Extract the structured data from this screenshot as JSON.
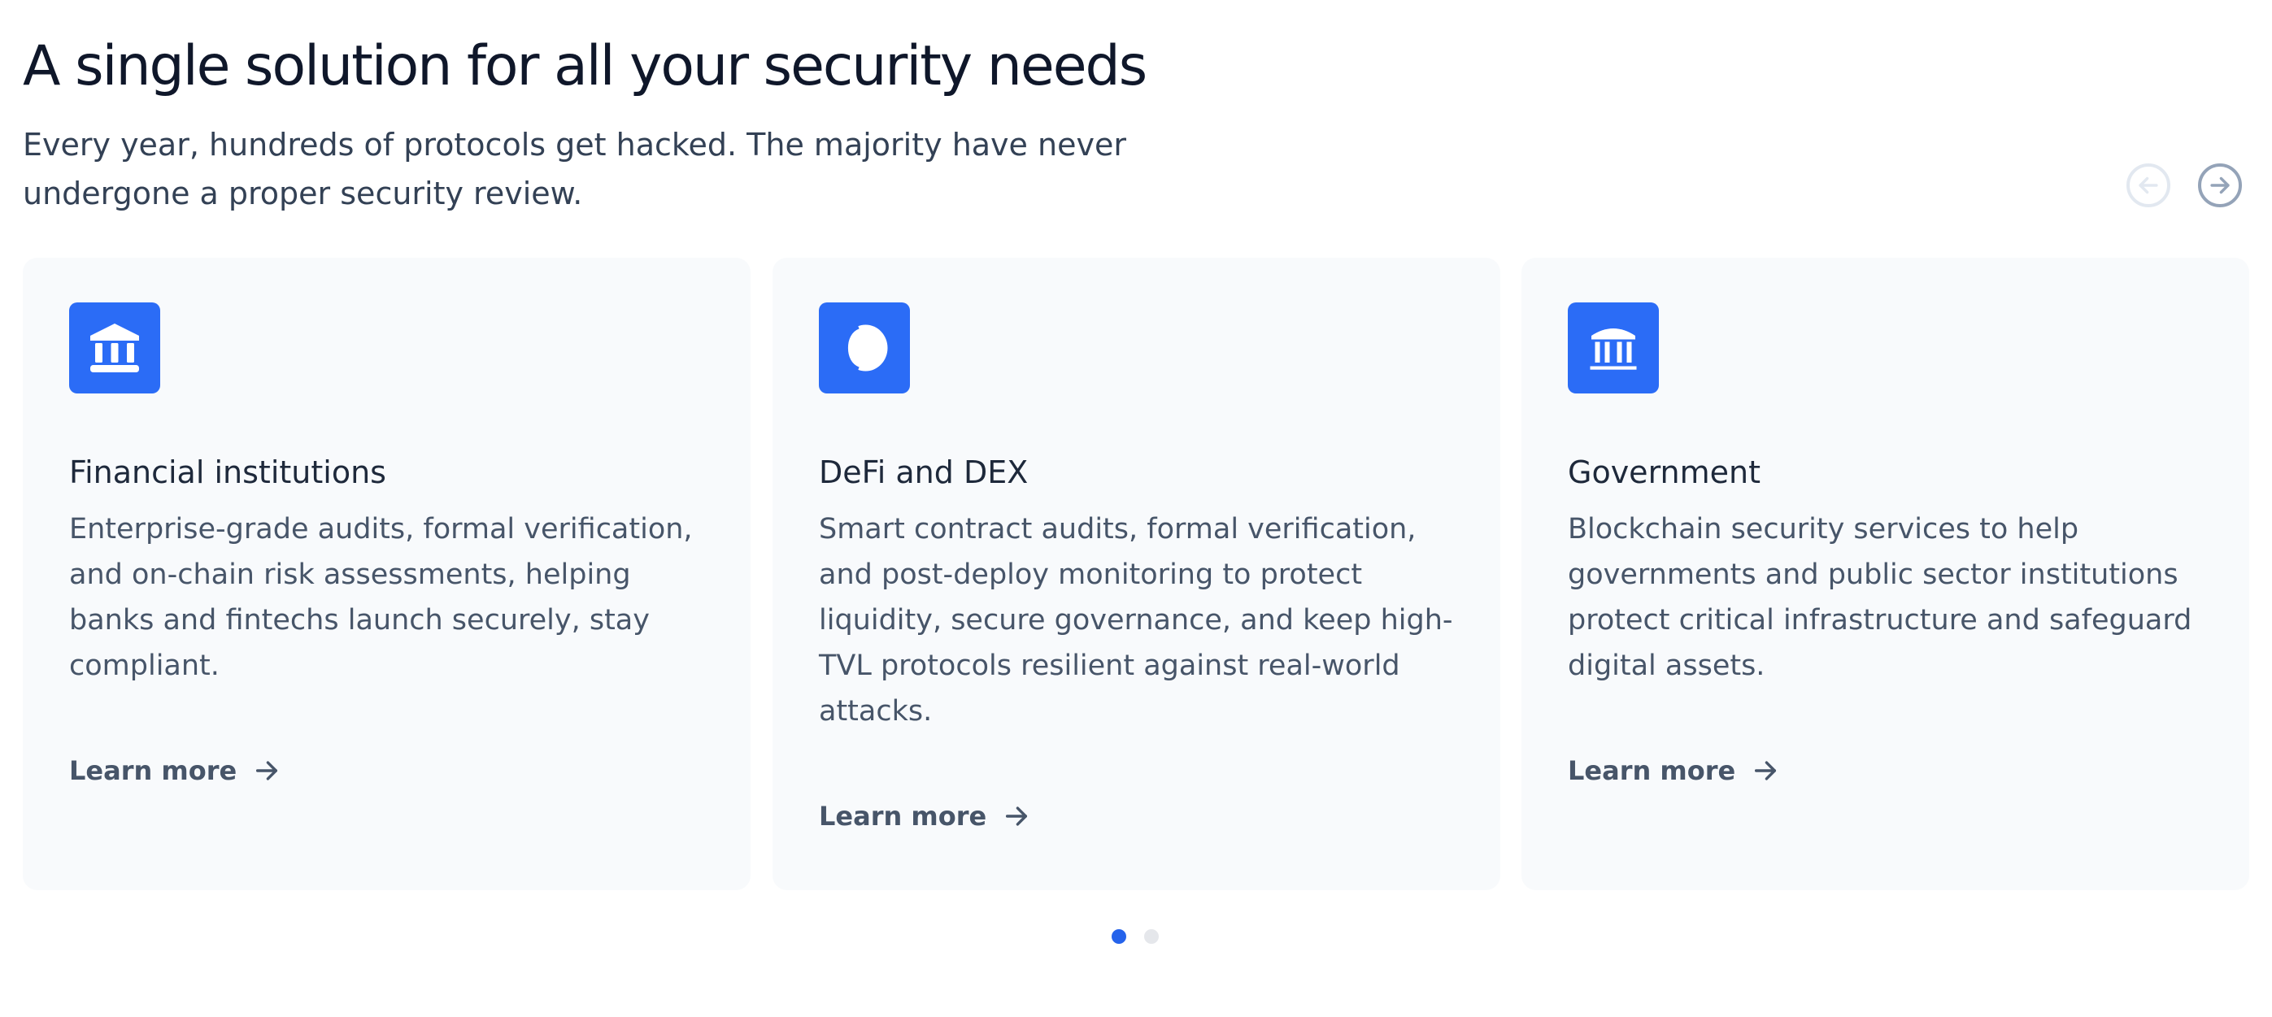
{
  "header": {
    "title": "A single solution for all your security needs",
    "subtitle": "Every year, hundreds of protocols get hacked. The majority have never undergone a proper security review."
  },
  "carousel_nav": {
    "prev_icon": "arrow-left-circle-icon",
    "next_icon": "arrow-right-circle-icon",
    "prev_enabled": false,
    "next_enabled": true
  },
  "cards": [
    {
      "icon": "bank-building-icon",
      "title": "Financial institutions",
      "description": "Enterprise-grade audits, formal verification, and on-chain risk assessments, helping banks and fintechs launch securely, stay compliant.",
      "link_label": "Learn more"
    },
    {
      "icon": "coin-icon",
      "title": "DeFi and DEX",
      "description": "Smart contract audits, formal verification, and post-deploy monitoring to protect liquidity, secure governance, and keep high-TVL protocols resilient against real-world attacks.",
      "link_label": "Learn more"
    },
    {
      "icon": "government-building-icon",
      "title": "Government",
      "description": "Blockchain security services to help governments and public sector institutions protect critical infrastructure and safeguard digital assets.",
      "link_label": "Learn more"
    }
  ],
  "pagination": {
    "total_pages": 2,
    "active_page": 1
  },
  "colors": {
    "accent": "#2b6cf6",
    "active_dot": "#2563eb",
    "card_background": "#f8fafc",
    "heading": "#0f172a",
    "body_text": "#475569"
  }
}
